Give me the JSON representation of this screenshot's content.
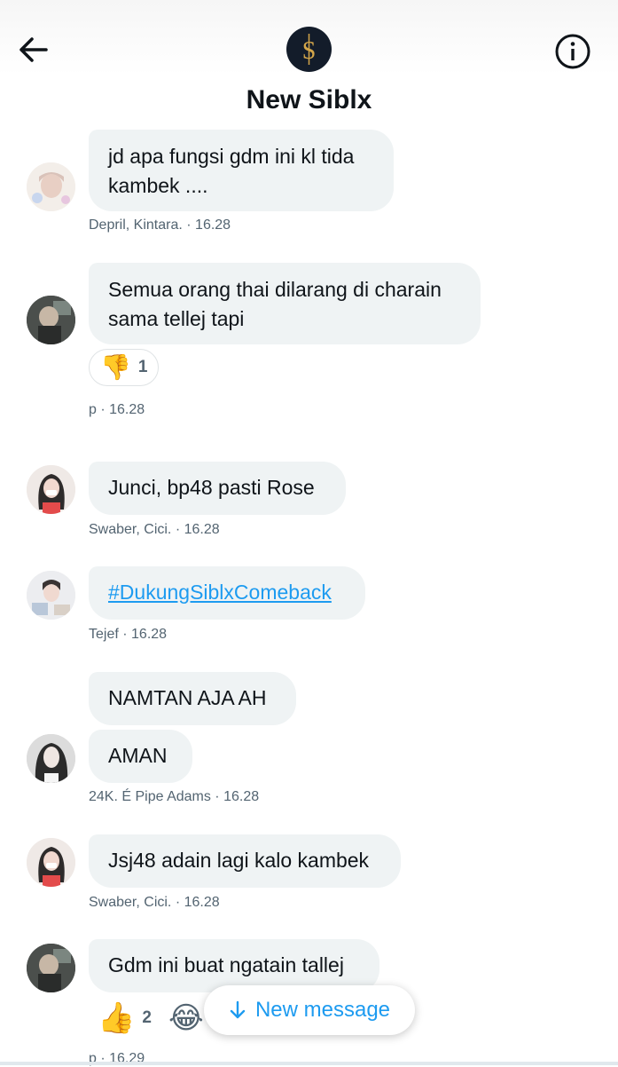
{
  "header": {
    "title": "New Siblx",
    "back_icon": "arrow-left-icon",
    "info_icon": "info-circle-icon",
    "avatar_letter": "S",
    "avatar_bg": "#131c2a",
    "avatar_fg": "#d4a64a"
  },
  "messages": [
    {
      "text": "jd apa fungsi gdm ini kl tida kambek ....",
      "meta": "Depril, Kintara. · 16.28"
    },
    {
      "text": "Semua orang thai dilarang di charain sama tellej tapi",
      "reaction_icon": "thumbs-down-icon",
      "reaction_count": "1",
      "meta": "p · 16.28"
    },
    {
      "text": "Junci, bp48 pasti Rose",
      "meta": "Swaber, Cici. · 16.28"
    },
    {
      "text": "#DukungSiblxComeback",
      "meta": "Tejef · 16.28"
    },
    {
      "text": "NAMTAN AJA AH",
      "text2": "AMAN",
      "meta": "24K. É Pipe Adams · 16.28"
    },
    {
      "text": "Jsj48 adain lagi kalo kambek",
      "meta": "Swaber, Cici. · 16.28"
    },
    {
      "text": "Gdm ini buat ngatain tallej",
      "reaction_icon": "thumbs-up-icon",
      "reaction_count": "2",
      "reaction2_icon": "tears-of-joy-icon",
      "meta": "p · 16.29"
    }
  ],
  "new_message_button": {
    "label": "New message",
    "icon": "arrow-down-icon"
  },
  "colors": {
    "accent": "#1d9bf0",
    "bubble": "#eff3f4",
    "meta": "#536471"
  }
}
